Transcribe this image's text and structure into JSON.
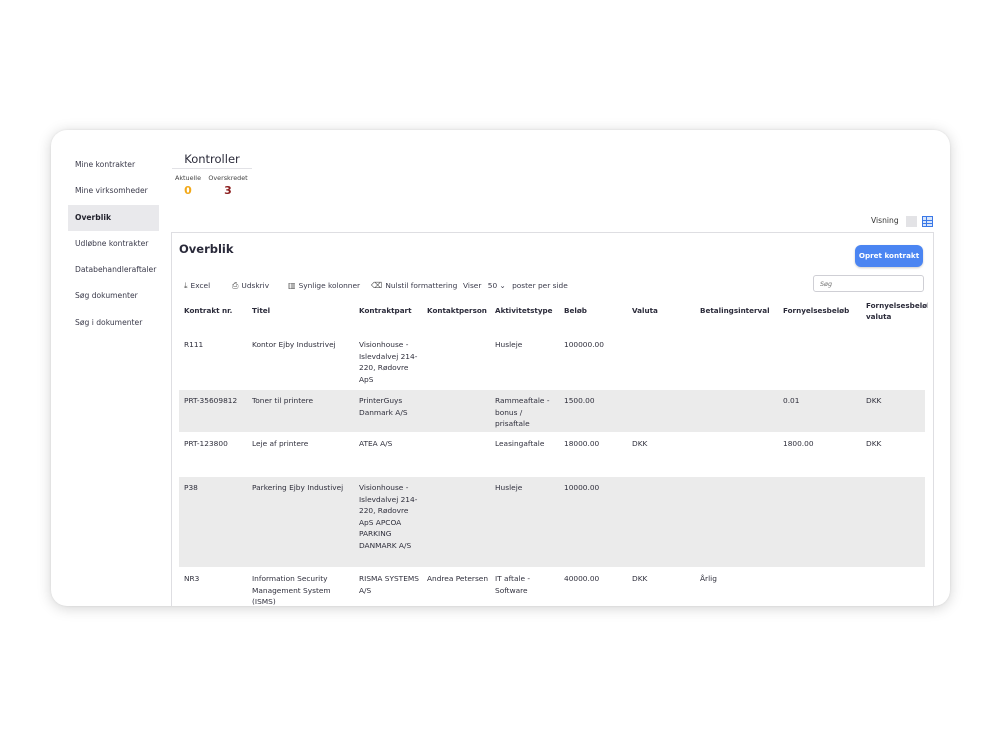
{
  "sidebar": {
    "items": [
      {
        "label": "Mine kontrakter"
      },
      {
        "label": "Mine virksomheder"
      },
      {
        "label": "Overblik"
      },
      {
        "label": "Udløbne kontrakter"
      },
      {
        "label": "Databehandleraftaler"
      },
      {
        "label": "Søg dokumenter"
      },
      {
        "label": "Søg i dokumenter"
      }
    ]
  },
  "kontroller": {
    "title": "Kontroller",
    "aktuelle_label": "Aktuelle",
    "aktuelle_value": "0",
    "overskredet_label": "Overskredet",
    "overskredet_value": "3"
  },
  "visning": {
    "label": "Visning"
  },
  "panel": {
    "title": "Overblik",
    "create_button": "Opret kontrakt"
  },
  "toolbar": {
    "excel": "Excel",
    "print": "Udskriv",
    "columns": "Synlige kolonner",
    "reset": "Nulstil formattering",
    "show_prefix": "Viser",
    "page_size": "50",
    "show_suffix": "poster per side",
    "search_placeholder": "Søg"
  },
  "colors": {
    "accent": "#4b85f2",
    "aktuelle": "#f2a817",
    "overskredet": "#8b1d1d"
  },
  "table": {
    "headers": [
      "Kontrakt nr.",
      "Titel",
      "Kontraktpart",
      "Kontaktperson",
      "Aktivitetstype",
      "Beløb",
      "Valuta",
      "Betalingsinterval",
      "Fornyelsesbeløb",
      "Fornyelsesbeløb valuta"
    ],
    "rows": [
      {
        "nr": "R111",
        "titel": "Kontor Ejby Industrivej",
        "part": "Visionhouse - Islevdalvej 214-220, Rødovre ApS",
        "kontakt": "",
        "type": "Husleje",
        "belob": "100000.00",
        "valuta": "",
        "interval": "",
        "forny": "",
        "forny_valuta": ""
      },
      {
        "nr": "PRT-35609812",
        "titel": "Toner til printere",
        "part": "PrinterGuys Danmark A/S",
        "kontakt": "",
        "type": "Rammeaftale - bonus / prisaftale",
        "belob": "1500.00",
        "valuta": "",
        "interval": "",
        "forny": "0.01",
        "forny_valuta": "DKK"
      },
      {
        "nr": "PRT-123800",
        "titel": "Leje af printere",
        "part": "ATEA A/S",
        "kontakt": "",
        "type": "Leasingaftale",
        "belob": "18000.00",
        "valuta": "DKK",
        "interval": "",
        "forny": "1800.00",
        "forny_valuta": "DKK"
      },
      {
        "nr": "P38",
        "titel": "Parkering Ejby Industivej",
        "part": "Visionhouse - Islevdalvej 214-220, Rødovre ApS APCOA PARKING DANMARK A/S",
        "kontakt": "",
        "type": "Husleje",
        "belob": "10000.00",
        "valuta": "",
        "interval": "",
        "forny": "",
        "forny_valuta": ""
      },
      {
        "nr": "NR3",
        "titel": "Information Security Management System (ISMS)",
        "part": "RISMA SYSTEMS A/S",
        "kontakt": "Andrea Petersen",
        "type": "IT aftale - Software",
        "belob": "40000.00",
        "valuta": "DKK",
        "interval": "Årlig",
        "forny": "",
        "forny_valuta": ""
      }
    ]
  }
}
